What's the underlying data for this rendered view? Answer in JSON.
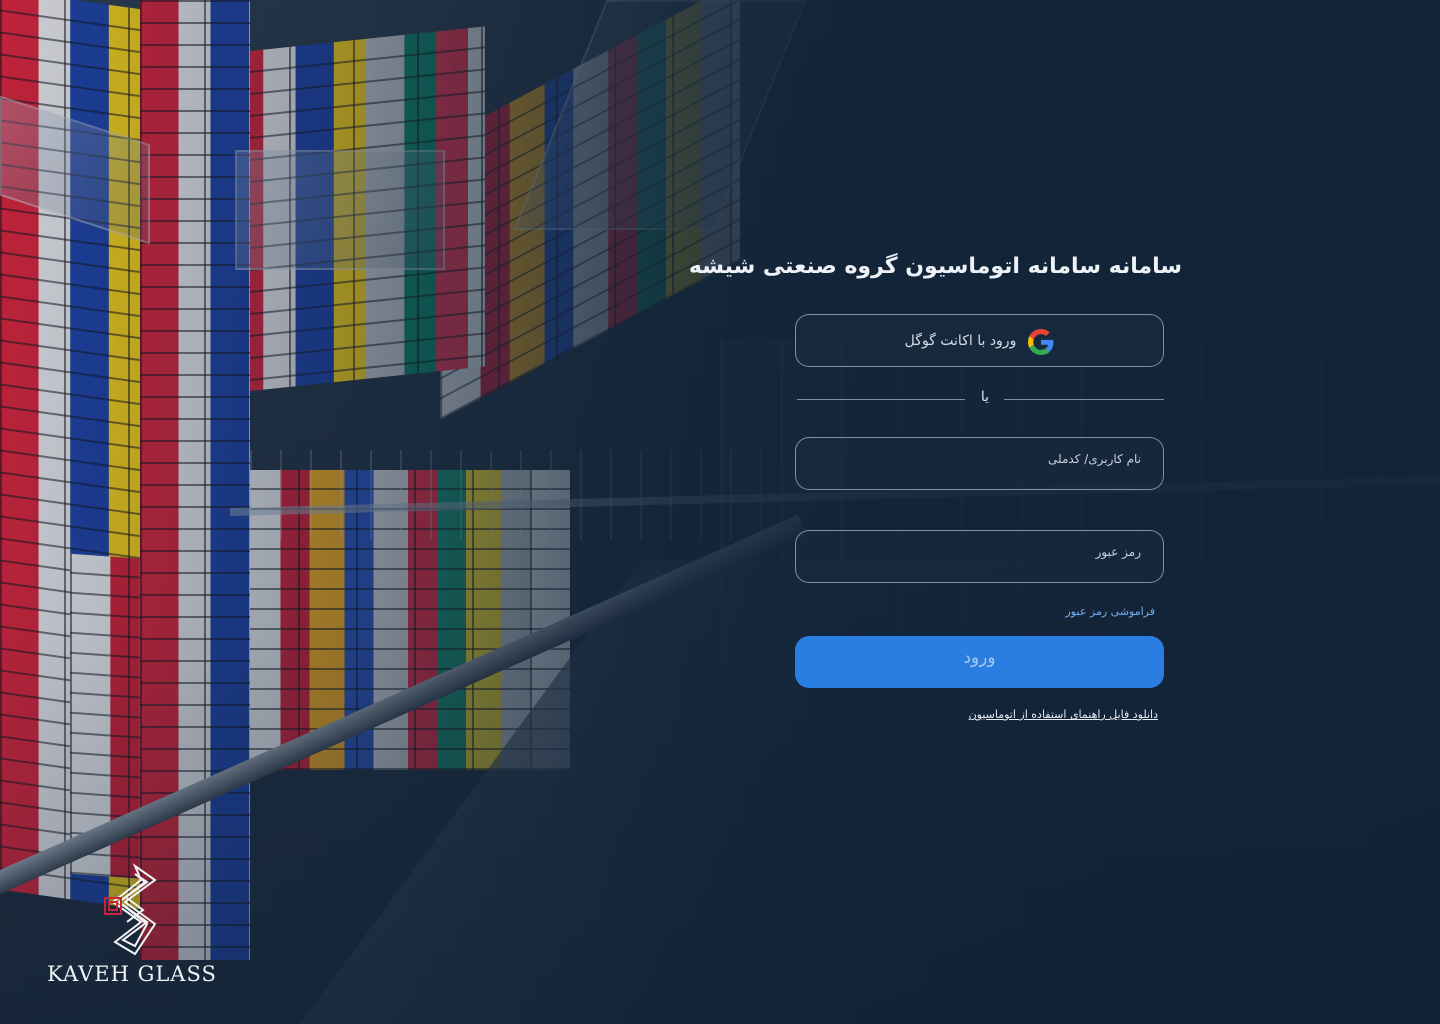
{
  "page": {
    "title": "سامانه سامانه اتوماسیون گروه صنعتی شیشه"
  },
  "brand": {
    "name": "KAVEH  GLASS",
    "logo_icon": "kaveh-glass-logo-icon"
  },
  "login": {
    "google_label": "ورود با اکانت گوگل",
    "google_icon": "google-icon",
    "divider_label": "یا",
    "username_placeholder": "نام کاربری/ کدملی",
    "password_placeholder": "رمز عبور",
    "forgot_label": "فراموشی رمز عبور",
    "submit_label": "ورود",
    "manual_link_label": "دانلود فایل راهنمای استفاده از اتوماسیون"
  },
  "colors": {
    "accent": "#2a7de1",
    "link": "#6fb1f2",
    "overlay": "#102236",
    "logo_red": "#c8233a"
  }
}
